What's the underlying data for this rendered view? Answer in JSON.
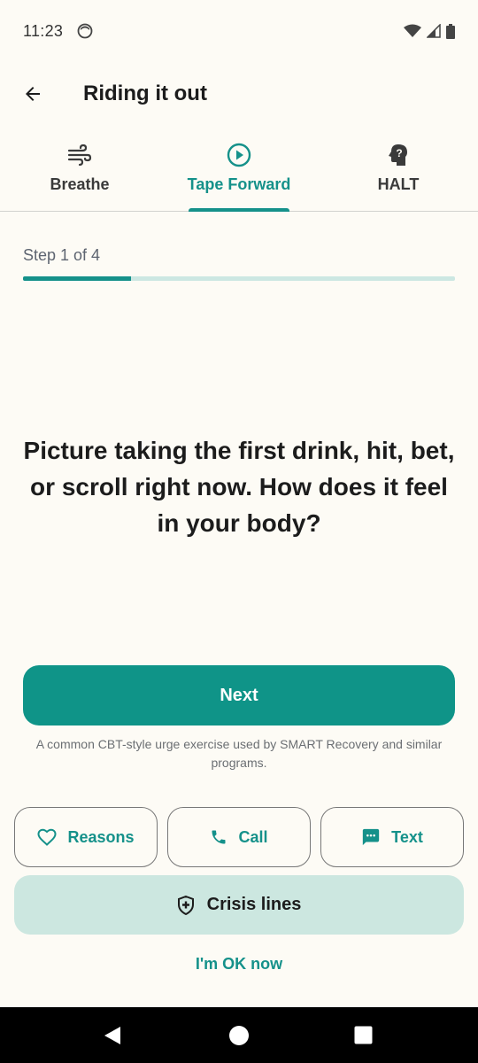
{
  "status_bar": {
    "time": "11:23",
    "icons": [
      "face-icon",
      "wifi-icon",
      "signal-icon",
      "battery-icon"
    ]
  },
  "app_bar": {
    "title": "Riding it out",
    "back_icon": "arrow-left-icon"
  },
  "tabs": [
    {
      "label": "Breathe",
      "icon": "wind-icon",
      "active": false
    },
    {
      "label": "Tape Forward",
      "icon": "play-circle-icon",
      "active": true
    },
    {
      "label": "HALT",
      "icon": "head-question-icon",
      "active": false
    }
  ],
  "step": {
    "label": "Step 1 of 4",
    "current": 1,
    "total": 4
  },
  "prompt": "Picture taking the first drink, hit, bet, or scroll right now. How does it feel in your body?",
  "next_button": "Next",
  "footnote": "A common CBT-style urge exercise used by SMART Recovery and similar programs.",
  "actions": {
    "reasons": "Reasons",
    "call": "Call",
    "text": "Text"
  },
  "crisis_button": "Crisis lines",
  "ok_link": "I'm OK now",
  "colors": {
    "accent": "#0f9488",
    "accent_text": "#15918a",
    "background": "#fdfbf5",
    "crisis_bg": "#cce7e0"
  }
}
